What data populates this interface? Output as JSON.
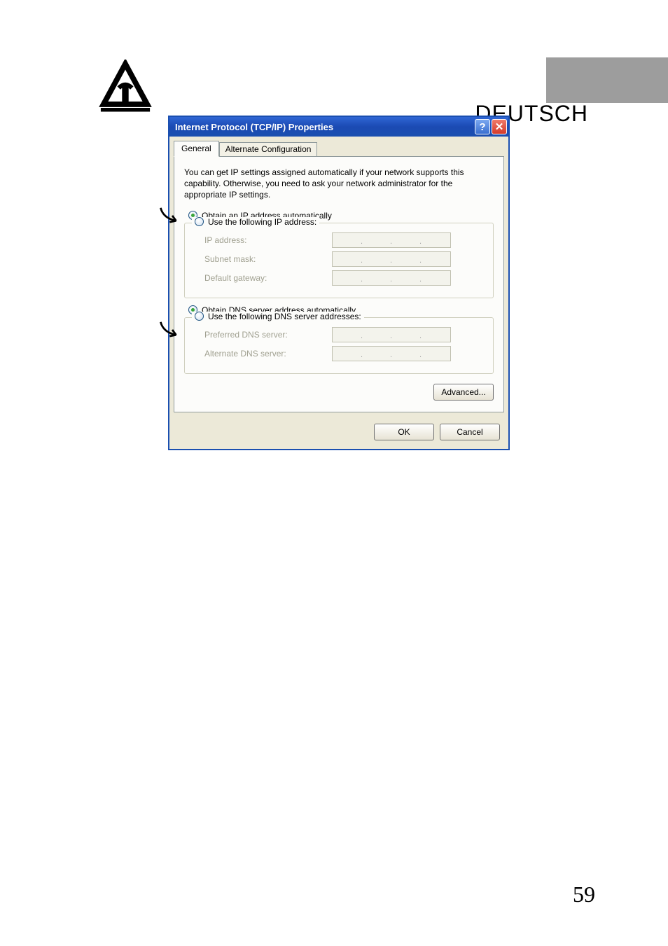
{
  "header": {
    "language": "DEUTSCH"
  },
  "dialog": {
    "title": "Internet Protocol (TCP/IP) Properties",
    "tabs": {
      "general": "General",
      "alternate": "Alternate Configuration"
    },
    "description": "You can get IP settings assigned automatically if your network supports this capability. Otherwise, you need to ask your network administrator for the appropriate IP settings.",
    "ip_section": {
      "obtain_auto": "Obtain an IP address automatically",
      "use_following": "Use the following IP address:",
      "ip_address_label": "IP address:",
      "subnet_mask_label": "Subnet mask:",
      "default_gateway_label": "Default gateway:"
    },
    "dns_section": {
      "obtain_auto": "Obtain DNS server address automatically",
      "use_following": "Use the following DNS server addresses:",
      "preferred_label": "Preferred DNS server:",
      "alternate_label": "Alternate DNS server:"
    },
    "buttons": {
      "advanced": "Advanced...",
      "ok": "OK",
      "cancel": "Cancel"
    }
  },
  "page_number": "59"
}
